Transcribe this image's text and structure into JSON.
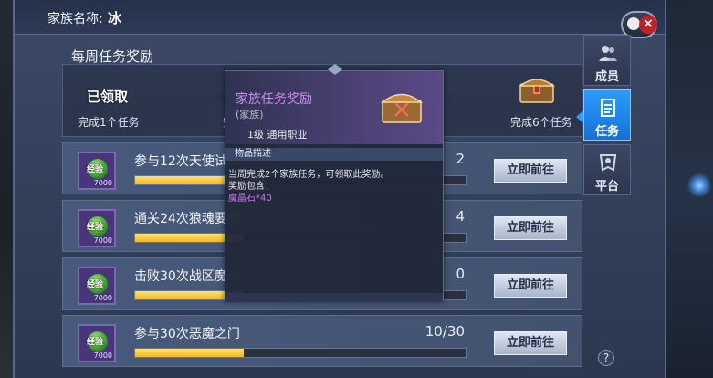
{
  "window": {
    "title_label": "家族名称:",
    "family_name": "冰"
  },
  "weekly": {
    "title": "每周任务奖励",
    "claimed_label": "已领取",
    "milestones": [
      {
        "label": "完成1个任务"
      },
      {
        "label": "完成"
      },
      {
        "label": "完成6个任务"
      }
    ]
  },
  "tasks": [
    {
      "name": "参与12次天使试炼",
      "progress_text": "2",
      "fill": 0.4,
      "reward_label": "经验",
      "reward_count": "7000",
      "button": "立即前往"
    },
    {
      "name": "通关24次狼魂要塞",
      "progress_text": "4",
      "fill": 0.33,
      "reward_label": "经验",
      "reward_count": "7000",
      "button": "立即前往"
    },
    {
      "name": "击败30次战区魔王",
      "progress_text": "0",
      "fill": 0.33,
      "reward_label": "经验",
      "reward_count": "7000",
      "button": "立即前往"
    },
    {
      "name": "参与30次恶魔之门",
      "progress_text": "10/30",
      "fill": 0.33,
      "reward_label": "经验",
      "reward_count": "7000",
      "button": "立即前往"
    }
  ],
  "side_tabs": [
    {
      "label": "成员",
      "icon": "members-icon",
      "active": false
    },
    {
      "label": "任务",
      "icon": "task-icon",
      "active": true
    },
    {
      "label": "平台",
      "icon": "platform-icon",
      "active": false
    }
  ],
  "help": {
    "label": "?"
  },
  "tooltip": {
    "title": "家族任务奖励",
    "subtitle": "(家族)",
    "level": "1级 通用职业",
    "desc_header": "物品描述",
    "desc_line1": "当周完成2个家族任务，可领取此奖励。",
    "desc_line2": "奖励包含：",
    "reward": "魔晶石*40"
  },
  "colors": {
    "accent_blue": "#2b9cff",
    "progress_yellow": "#f2b528",
    "tooltip_purple": "#cf8ff0",
    "close_red": "#c3202b"
  }
}
